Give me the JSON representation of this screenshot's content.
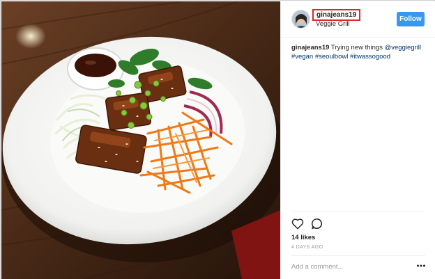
{
  "post": {
    "username": "ginajeans19",
    "location": "Veggie Grill",
    "follow_label": "Follow",
    "caption": {
      "username": "ginajeans19",
      "text": "Trying new things",
      "mention": "@veggiegrill",
      "hashtags": [
        "#vegan",
        "#seoulbowl",
        "#itwassogood"
      ]
    },
    "likes_text": "14 likes",
    "timestamp": "4 DAYS AGO",
    "comment_placeholder": "Add a comment...",
    "icons": {
      "like": "heart-icon",
      "comment": "comment-bubble-icon",
      "more": "more-options-icon"
    }
  },
  "colors": {
    "follow_button": "#3897f0",
    "link": "#003569",
    "highlight_border": "#d82a2a"
  }
}
